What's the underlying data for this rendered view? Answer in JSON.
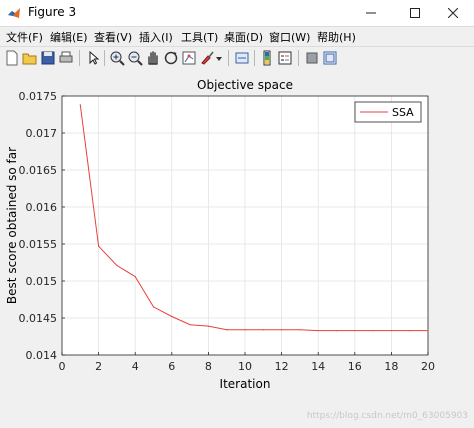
{
  "window": {
    "title": "Figure 3",
    "minimize_icon": "minimize-icon",
    "maximize_icon": "maximize-icon",
    "close_icon": "close-icon"
  },
  "menubar": {
    "items": [
      "文件(F)",
      "编辑(E)",
      "查看(V)",
      "插入(I)",
      "工具(T)",
      "桌面(D)",
      "窗口(W)",
      "帮助(H)"
    ]
  },
  "toolbar": {
    "icons": [
      "new-figure-icon",
      "open-file-icon",
      "save-icon",
      "print-icon",
      "select-arrow-icon",
      "zoom-in-icon",
      "zoom-out-icon",
      "pan-icon",
      "rotate-3d-icon",
      "data-cursor-icon",
      "brush-icon",
      "brush-dropdown-icon",
      "link-plot-icon",
      "insert-colorbar-icon",
      "insert-legend-icon",
      "hide-plot-tools-icon",
      "show-plot-tools-icon"
    ]
  },
  "colors": {
    "line": "#e8413d",
    "grid": "#e3e3e3",
    "axes": "#262626"
  },
  "watermark": "https://blog.csdn.net/m0_63005903",
  "chart_data": {
    "type": "line",
    "title": "Objective space",
    "xlabel": "Iteration",
    "ylabel": "Best score obtained so far",
    "xlim": [
      0,
      20
    ],
    "ylim": [
      0.014,
      0.0175
    ],
    "xticks": [
      "0",
      "2",
      "4",
      "6",
      "8",
      "10",
      "12",
      "14",
      "16",
      "18",
      "20"
    ],
    "yticks": [
      "0.014",
      "0.0145",
      "0.015",
      "0.0155",
      "0.016",
      "0.0165",
      "0.017",
      "0.0175"
    ],
    "grid": true,
    "legend_position": "top-right",
    "series": [
      {
        "name": "SSA",
        "x": [
          1,
          2,
          3,
          4,
          5,
          6,
          7,
          8,
          9,
          10,
          11,
          12,
          13,
          14,
          15,
          16,
          17,
          18,
          19,
          20
        ],
        "values": [
          0.01738,
          0.01547,
          0.01521,
          0.01506,
          0.01465,
          0.01452,
          0.01441,
          0.01439,
          0.01434,
          0.01434,
          0.01434,
          0.01434,
          0.01434,
          0.01433,
          0.01433,
          0.01433,
          0.01433,
          0.01433,
          0.01433,
          0.01433
        ]
      }
    ]
  }
}
